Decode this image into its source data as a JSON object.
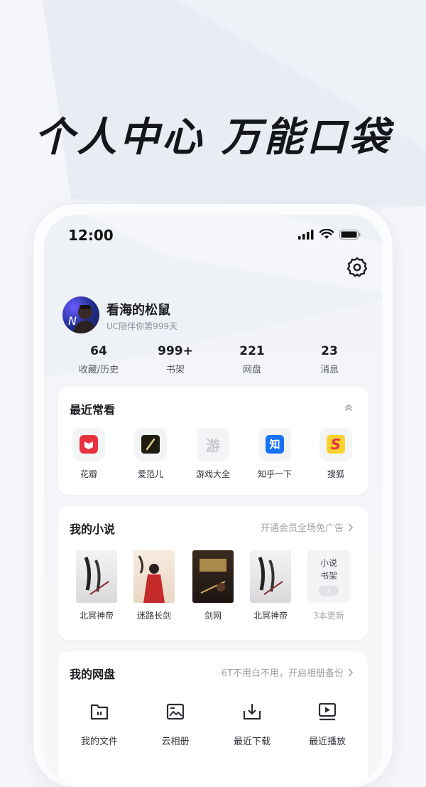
{
  "headline": "个人中心 万能口袋",
  "status_bar": {
    "time": "12:00"
  },
  "profile": {
    "username": "看海的松鼠",
    "subtitle": "UC陪伴你第999天"
  },
  "stats": [
    {
      "value": "64",
      "label": "收藏/历史"
    },
    {
      "value": "999+",
      "label": "书架"
    },
    {
      "value": "221",
      "label": "网盘"
    },
    {
      "value": "23",
      "label": "消息"
    }
  ],
  "recent": {
    "title": "最近常看",
    "apps": [
      {
        "label": "花瓣",
        "icon": "huaban-icon",
        "color": "#e8333f"
      },
      {
        "label": "爱范儿",
        "icon": "ifanr-icon",
        "color": "#1f1d12"
      },
      {
        "label": "游戏大全",
        "icon": "game-icon",
        "glyph": "游",
        "color": "#c7c9ce"
      },
      {
        "label": "知乎一下",
        "icon": "zhihu-icon",
        "glyph": "知",
        "color": "#1772f6"
      },
      {
        "label": "搜狐",
        "icon": "sohu-icon",
        "glyph": "S",
        "color": "#fbd22c"
      }
    ]
  },
  "novels": {
    "title": "我的小说",
    "promo": "开通会员全场免广告",
    "books": [
      {
        "label": "北冥神帝"
      },
      {
        "label": "迷路长剑"
      },
      {
        "label": "剑网"
      },
      {
        "label": "北冥神帝"
      }
    ],
    "shelf": {
      "line1": "小说",
      "line2": "书架",
      "update": "3本更新"
    }
  },
  "disk": {
    "title": "我的网盘",
    "promo": "6T不用白不用，开启相册备份",
    "items": [
      {
        "label": "我的文件",
        "icon": "folder-icon"
      },
      {
        "label": "云相册",
        "icon": "album-icon"
      },
      {
        "label": "最近下载",
        "icon": "download-icon"
      },
      {
        "label": "最近播放",
        "icon": "play-icon"
      }
    ]
  }
}
